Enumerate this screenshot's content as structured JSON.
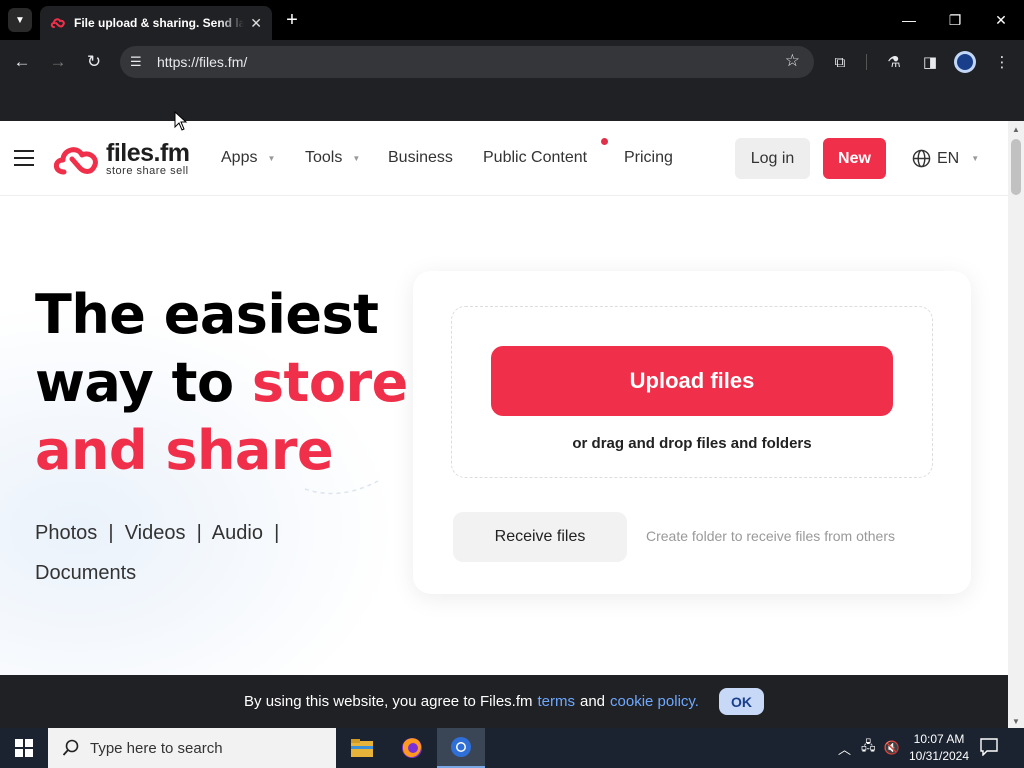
{
  "browser": {
    "tab_title": "File upload & sharing. Send large files",
    "url": "https://files.fm/"
  },
  "site": {
    "logo": {
      "name": "files.fm",
      "tagline": "store share sell",
      "color": "#f0304a"
    },
    "nav": {
      "apps": "Apps",
      "tools": "Tools",
      "business": "Business",
      "public_content": "Public Content",
      "pricing": "Pricing"
    },
    "login": "Log in",
    "new": "New",
    "language": "EN",
    "hero": {
      "line1": "The easiest",
      "line2_a": "way to ",
      "line2_b": "store",
      "line3": "and share",
      "media_line1": "Photos  |  Videos  |  Audio  |",
      "media_line2": "Documents"
    },
    "upload": {
      "button": "Upload files",
      "drag_text": "or drag and drop files and folders",
      "receive_button": "Receive files",
      "receive_hint": "Create folder to receive files from others"
    },
    "cookie": {
      "text_prefix": "By using this website, you agree to Files.fm",
      "terms": "terms",
      "and": "and",
      "policy": "cookie policy.",
      "ok": "OK"
    },
    "accent_color": "#f0304a"
  },
  "taskbar": {
    "search_placeholder": "Type here to search",
    "time": "10:07 AM",
    "date": "10/31/2024",
    "apps": [
      "file-explorer-icon",
      "firefox-icon",
      "chrome-icon"
    ]
  }
}
